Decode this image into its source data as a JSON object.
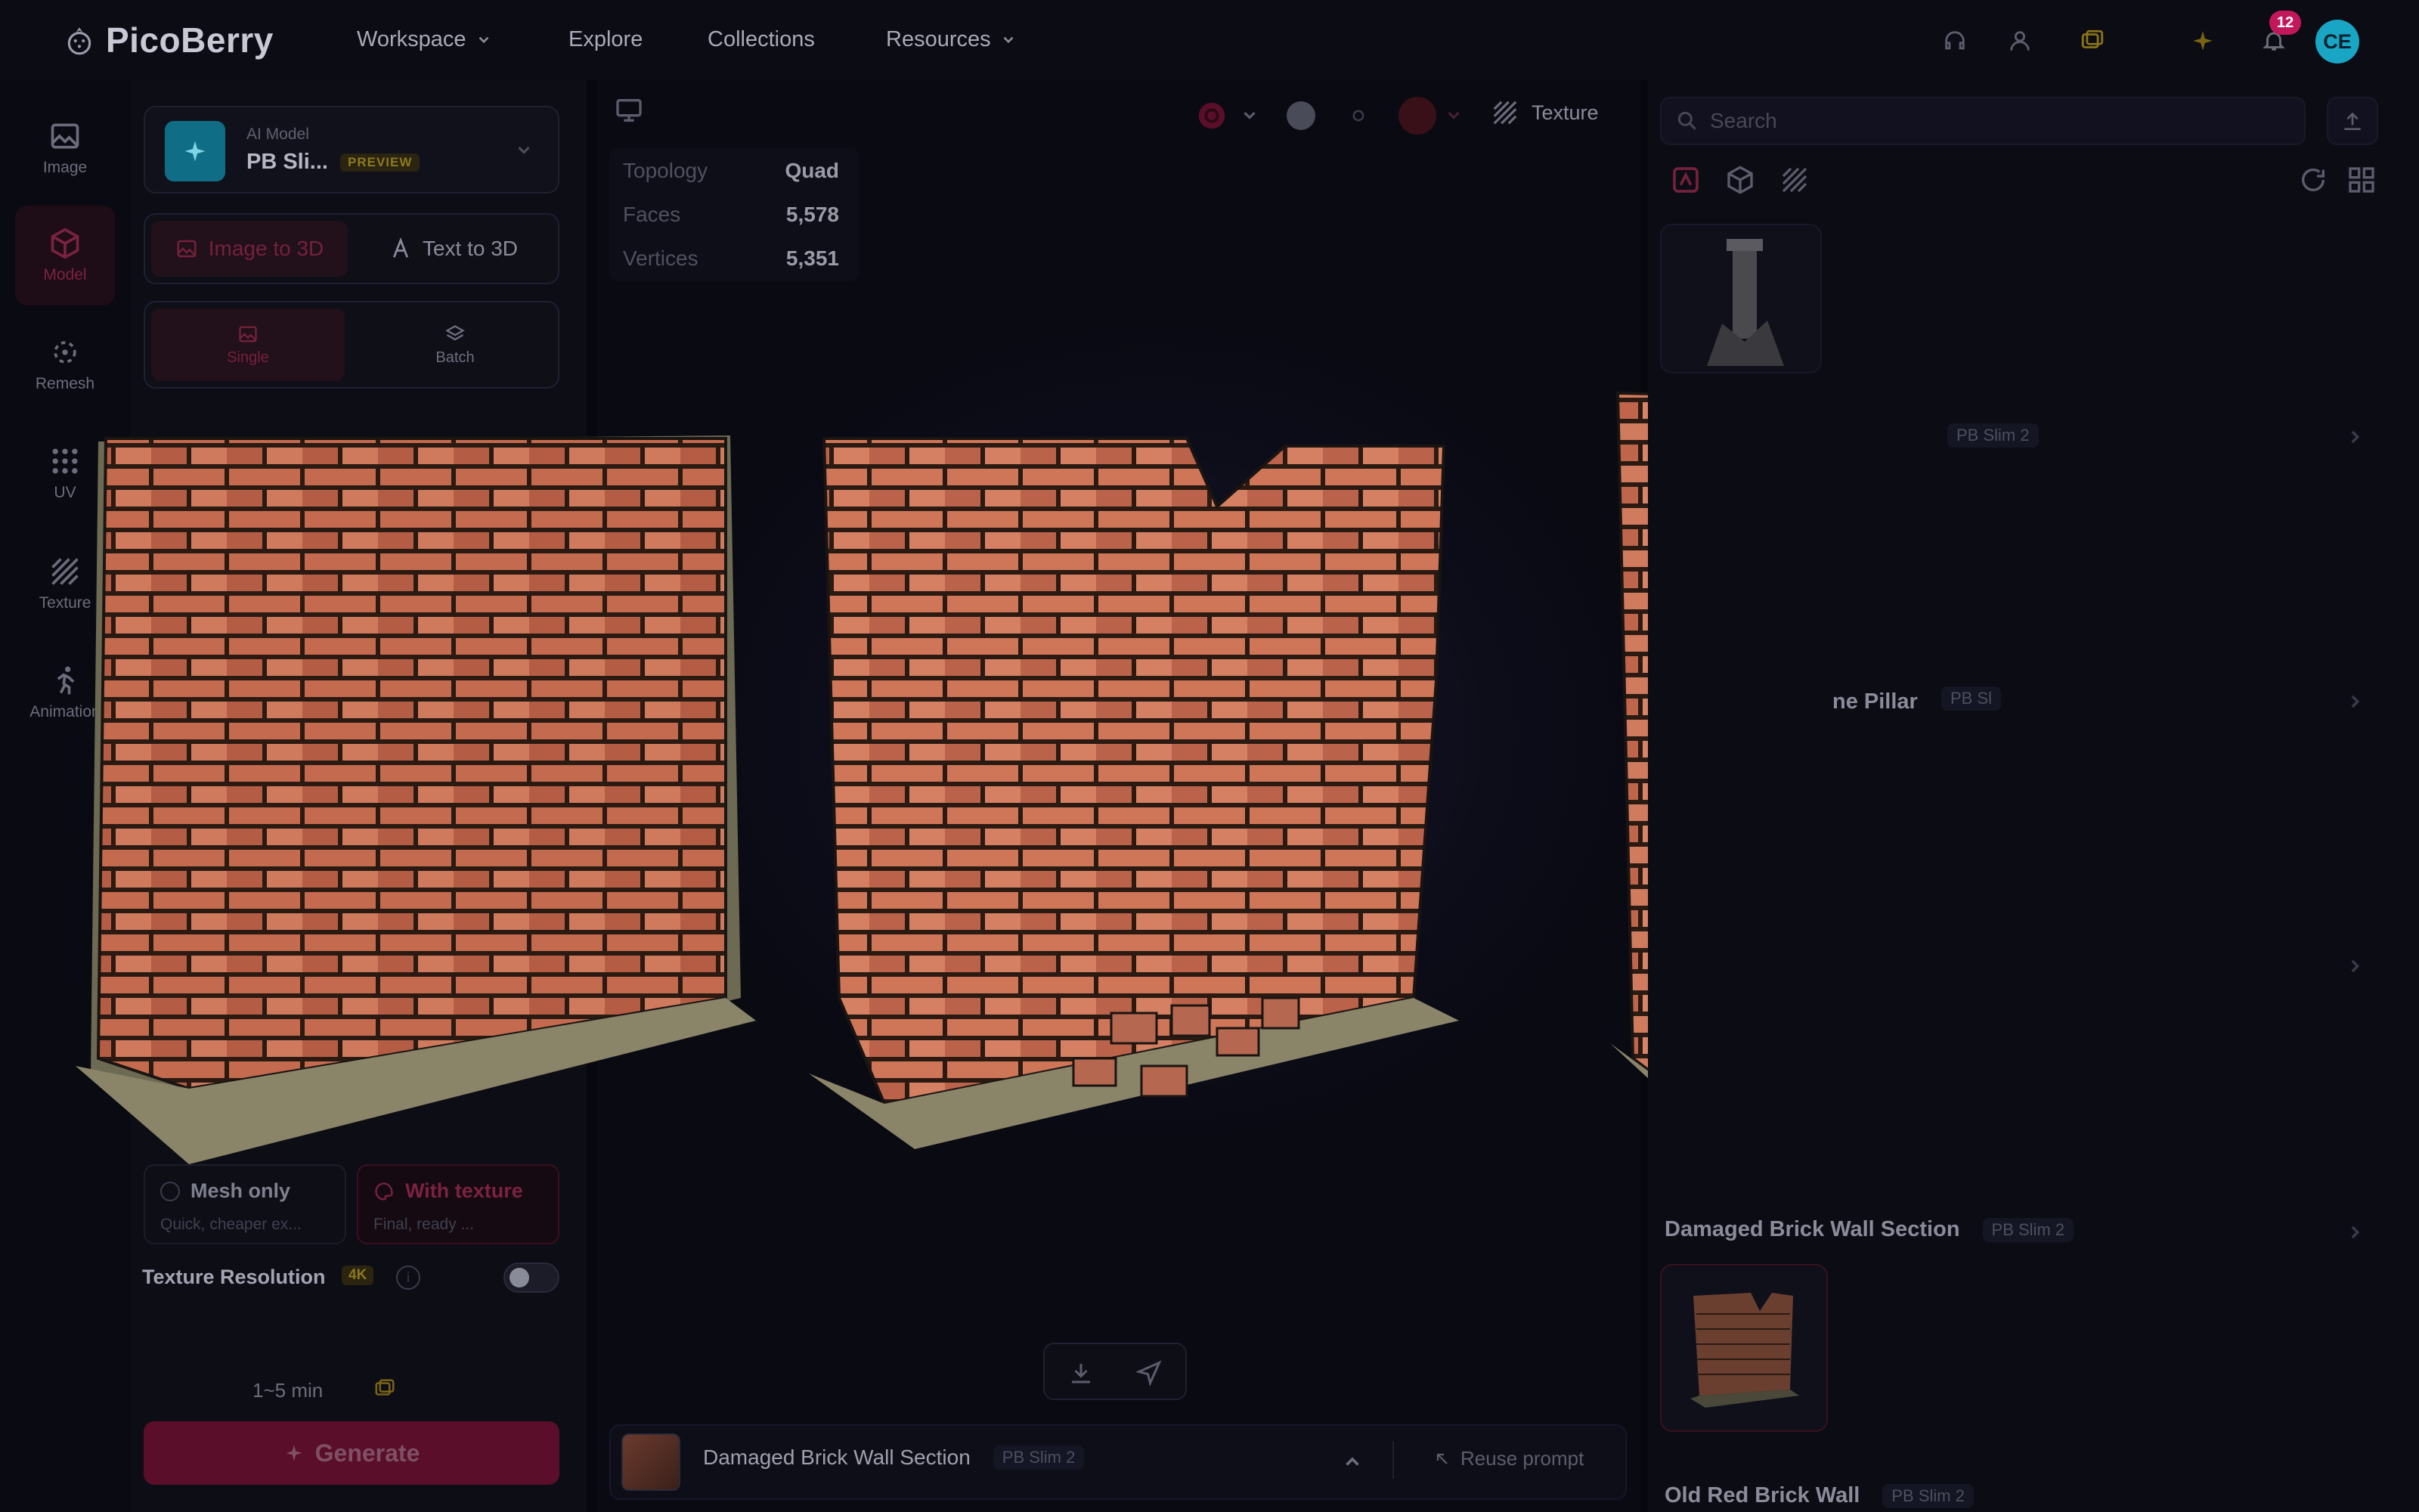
{
  "app": {
    "name": "PicoBerry",
    "accent": "#c2185b"
  },
  "header": {
    "nav": [
      {
        "label": "Workspace",
        "has_dropdown": true
      },
      {
        "label": "Explore",
        "has_dropdown": false
      },
      {
        "label": "Collections",
        "has_dropdown": false
      },
      {
        "label": "Resources",
        "has_dropdown": true
      }
    ],
    "notifications_count": "12",
    "avatar_initials": "CE"
  },
  "rail": {
    "items": [
      {
        "label": "Image",
        "icon": "image-icon",
        "active": false
      },
      {
        "label": "Model",
        "icon": "cube-icon",
        "active": true
      },
      {
        "label": "Remesh",
        "icon": "remesh-icon",
        "active": false
      },
      {
        "label": "UV",
        "icon": "uv-grid-icon",
        "active": false
      },
      {
        "label": "Texture",
        "icon": "texture-icon",
        "active": false
      },
      {
        "label": "Animation",
        "icon": "running-figure-icon",
        "active": false
      }
    ]
  },
  "panel": {
    "model": {
      "caption": "AI Model",
      "name": "PB Sli...",
      "badge": "PREVIEW"
    },
    "mode_tabs": [
      {
        "label": "Image to 3D",
        "active": true
      },
      {
        "label": "Text to 3D",
        "active": false
      }
    ],
    "input_tabs": [
      {
        "label": "Single",
        "active": true
      },
      {
        "label": "Batch",
        "active": false
      }
    ],
    "output_options": [
      {
        "title": "Mesh only",
        "desc": "Quick, cheaper ex...",
        "selected": false
      },
      {
        "title": "With texture",
        "desc": "Final, ready ...",
        "selected": true
      }
    ],
    "texture_resolution": {
      "label": "Texture Resolution",
      "value": "4K",
      "enabled": false
    },
    "eta": "1~5 min",
    "generate_label": "Generate"
  },
  "viewport": {
    "stats": [
      {
        "label": "Topology",
        "value": "Quad"
      },
      {
        "label": "Faces",
        "value": "5,578"
      },
      {
        "label": "Vertices",
        "value": "5,351"
      }
    ],
    "texture_label": "Texture",
    "bottom": {
      "name": "Damaged Brick Wall Section",
      "model_tag": "PB Slim 2",
      "reuse_label": "Reuse prompt"
    }
  },
  "right": {
    "search_placeholder": "Search",
    "items": [
      {
        "title": "",
        "tag": "PB Slim 2"
      },
      {
        "title": "ne Pillar",
        "tag": "PB Sl"
      },
      {
        "title": "Damaged Brick Wall Section",
        "tag": "PB Slim 2"
      },
      {
        "title": "Old Red Brick Wall",
        "tag": "PB Slim 2"
      }
    ]
  }
}
